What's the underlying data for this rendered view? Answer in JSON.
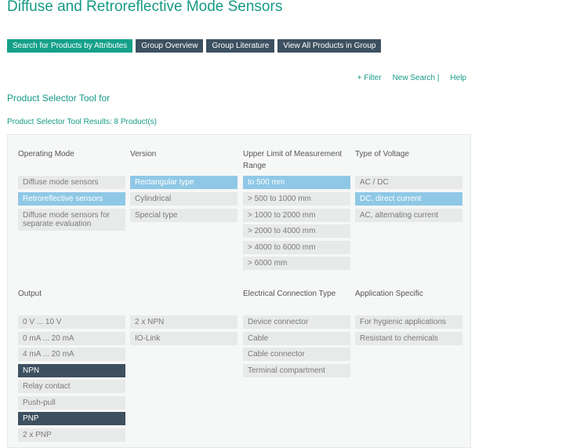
{
  "page_title": "Diffuse and Retroreflective Mode Sensors",
  "tabs": [
    {
      "label": "Search for Products by Attributes"
    },
    {
      "label": "Group Overview"
    },
    {
      "label": "Group Literature"
    },
    {
      "label": "View All Products in Group"
    }
  ],
  "links": {
    "filter": "+ Filter",
    "new_search": "New Search |",
    "help": "Help"
  },
  "section_title": "Product Selector Tool for",
  "results_text": "Product Selector Tool Results: 8 Product(s)",
  "filters": {
    "operating_mode": {
      "heading": "Operating Mode",
      "options": [
        "Diffuse mode sensors",
        "Retroreflective sensors",
        "Diffuse mode sensors for separate evaluation"
      ]
    },
    "version": {
      "heading": "Version",
      "options": [
        "Rectangular type",
        "Cylindrical",
        "Special type"
      ]
    },
    "upper_limit": {
      "heading": "Upper Limit of Measurement Range",
      "options": [
        "to 500 mm",
        "> 500 to 1000 mm",
        "> 1000 to 2000 mm",
        "> 2000 to 4000 mm",
        "> 4000 to 6000 mm",
        "> 6000 mm"
      ]
    },
    "voltage": {
      "heading": "Type of Voltage",
      "options": [
        "AC / DC",
        "DC, direct current",
        "AC, alternating current"
      ]
    },
    "output": {
      "heading": "Output",
      "options": [
        "0 V ... 10 V",
        "0 mA ... 20 mA",
        "4 mA ... 20 mA",
        "NPN",
        "Relay contact",
        "Push-pull",
        "PNP",
        "2 x PNP"
      ],
      "options_col2": [
        "2 x NPN",
        "IO-Link"
      ]
    },
    "connection": {
      "heading": "Electrical Connection Type",
      "options": [
        "Device connector",
        "Cable",
        "Cable connector",
        "Terminal compartment"
      ]
    },
    "application": {
      "heading": "Application Specific",
      "options": [
        "For hygienic applications",
        "Resistant to chemicals"
      ]
    }
  },
  "colors": {
    "accent": "#15a08a",
    "dark_tab": "#3d5060",
    "selected_light": "#8fc8e6"
  }
}
